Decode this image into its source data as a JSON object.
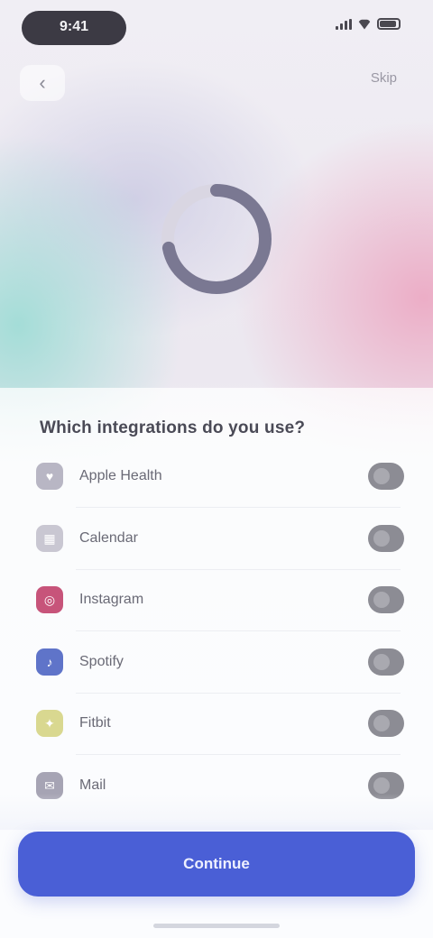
{
  "status_bar": {
    "time": "9:41",
    "icons": [
      "signal-icon",
      "wifi-icon",
      "battery-icon"
    ]
  },
  "nav": {
    "back_icon": "chevron-left-icon",
    "back_glyph": "‹",
    "skip_label": "Skip"
  },
  "progress": {
    "value": 0.72,
    "color": "#7a7892",
    "track_color": "#d9d6e2"
  },
  "sheet": {
    "title": "Which integrations do you use?",
    "items": [
      {
        "label": "Apple Health",
        "icon": "heart-icon",
        "glyph": "♥",
        "color": "#b8b6c4",
        "on": true
      },
      {
        "label": "Calendar",
        "icon": "calendar-icon",
        "glyph": "▦",
        "color": "#c9c7d2",
        "on": true
      },
      {
        "label": "Instagram",
        "icon": "camera-icon",
        "glyph": "◎",
        "color": "#c7547a",
        "on": true
      },
      {
        "label": "Spotify",
        "icon": "music-icon",
        "glyph": "♪",
        "color": "#5f74c9",
        "on": true
      },
      {
        "label": "Fitbit",
        "icon": "activity-icon",
        "glyph": "✦",
        "color": "#d9d890",
        "on": true
      },
      {
        "label": "Mail",
        "icon": "mail-icon",
        "glyph": "✉",
        "color": "#a6a4b4",
        "on": true
      }
    ]
  },
  "primary_button": {
    "label": "Continue",
    "color": "#4a5fd6"
  }
}
